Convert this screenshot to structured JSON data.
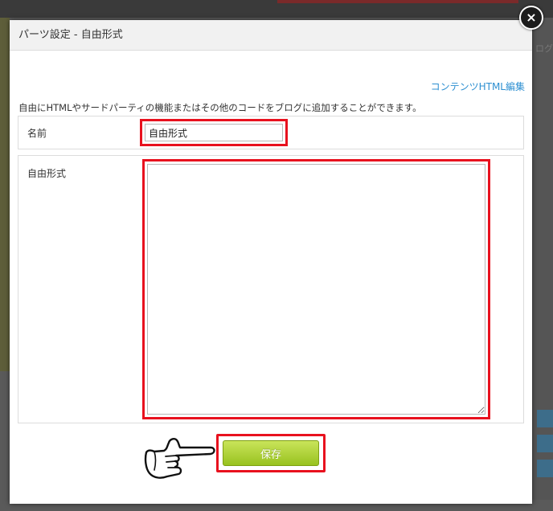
{
  "modal": {
    "title": "パーツ設定 - 自由形式",
    "close_symbol": "×",
    "html_edit_link": "コンテンツHTML編集",
    "description": "自由にHTMLやサードパーティの機能またはその他のコードをブログに追加することができます。",
    "name_field": {
      "label": "名前",
      "value": "自由形式"
    },
    "body_field": {
      "label": "自由形式",
      "value": ""
    },
    "save_label": "保存"
  },
  "background": {
    "partial_text": "ログ"
  },
  "colors": {
    "highlight": "#e8111e",
    "link": "#2d8fd1",
    "save_button": "#a8d12e"
  },
  "icons": {
    "close": "close-icon",
    "pointer": "pointing-hand-icon"
  }
}
